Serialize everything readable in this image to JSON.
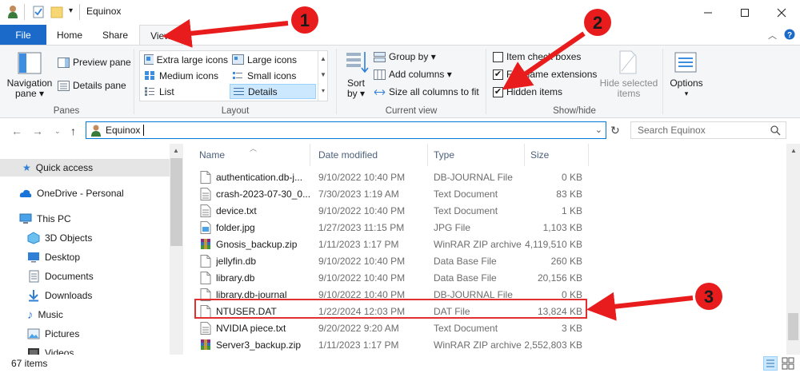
{
  "window": {
    "title": "Equinox",
    "minimize": "—",
    "maximize": "☐",
    "close": "✕"
  },
  "tabs": {
    "file": "File",
    "home": "Home",
    "share": "Share",
    "view": "View"
  },
  "ribbon": {
    "panes": {
      "label": "Panes",
      "navigation_pane": [
        "Navigation",
        "pane ▾"
      ],
      "preview_pane": "Preview pane",
      "details_pane": "Details pane"
    },
    "layout": {
      "label": "Layout",
      "items": [
        "Extra large icons",
        "Large icons",
        "Medium icons",
        "Small icons",
        "List",
        "Details"
      ],
      "selected": "Details"
    },
    "current_view": {
      "label": "Current view",
      "sort_by": [
        "Sort",
        "by ▾"
      ],
      "group_by": "Group by ▾",
      "add_columns": "Add columns ▾",
      "size_all_columns": "Size all columns to fit"
    },
    "show_hide": {
      "label": "Show/hide",
      "item_check_boxes": {
        "label": "Item check boxes",
        "checked": false
      },
      "file_name_extensions": {
        "label": "File name extensions",
        "checked": true
      },
      "hidden_items": {
        "label": "Hidden items",
        "checked": true
      },
      "hide_selected": [
        "Hide selected",
        "items"
      ]
    },
    "options": "Options"
  },
  "address": {
    "path": "Equinox",
    "search_placeholder": "Search Equinox"
  },
  "nav_pane": {
    "items": [
      {
        "label": "Quick access",
        "icon": "star-icon",
        "selected": true
      },
      {
        "label": "OneDrive - Personal",
        "icon": "cloud-icon"
      },
      {
        "label": "This PC",
        "icon": "computer-icon"
      },
      {
        "label": "3D Objects",
        "icon": "cube-icon"
      },
      {
        "label": "Desktop",
        "icon": "desktop-icon"
      },
      {
        "label": "Documents",
        "icon": "documents-icon"
      },
      {
        "label": "Downloads",
        "icon": "download-icon"
      },
      {
        "label": "Music",
        "icon": "music-icon"
      },
      {
        "label": "Pictures",
        "icon": "pictures-icon"
      },
      {
        "label": "Videos",
        "icon": "videos-icon"
      }
    ]
  },
  "columns": {
    "name": "Name",
    "date": "Date modified",
    "type": "Type",
    "size": "Size"
  },
  "files": [
    {
      "name": "authentication.db-j...",
      "date": "9/10/2022 10:40 PM",
      "type": "DB-JOURNAL File",
      "size": "0 KB",
      "icon": "file-icon"
    },
    {
      "name": "crash-2023-07-30_0...",
      "date": "7/30/2023 1:19 AM",
      "type": "Text Document",
      "size": "83 KB",
      "icon": "text-file-icon"
    },
    {
      "name": "device.txt",
      "date": "9/10/2022 10:40 PM",
      "type": "Text Document",
      "size": "1 KB",
      "icon": "text-file-icon"
    },
    {
      "name": "folder.jpg",
      "date": "1/27/2023 11:15 PM",
      "type": "JPG File",
      "size": "1,103 KB",
      "icon": "image-file-icon"
    },
    {
      "name": "Gnosis_backup.zip",
      "date": "1/11/2023 1:17 PM",
      "type": "WinRAR ZIP archive",
      "size": "4,119,510 KB",
      "icon": "winrar-icon"
    },
    {
      "name": "jellyfin.db",
      "date": "9/10/2022 10:40 PM",
      "type": "Data Base File",
      "size": "260 KB",
      "icon": "file-icon"
    },
    {
      "name": "library.db",
      "date": "9/10/2022 10:40 PM",
      "type": "Data Base File",
      "size": "20,156 KB",
      "icon": "file-icon"
    },
    {
      "name": "library.db-journal",
      "date": "9/10/2022 10:40 PM",
      "type": "DB-JOURNAL File",
      "size": "0 KB",
      "icon": "file-icon"
    },
    {
      "name": "NTUSER.DAT",
      "date": "1/22/2024 12:03 PM",
      "type": "DAT File",
      "size": "13,824 KB",
      "icon": "file-icon"
    },
    {
      "name": "NVIDIA piece.txt",
      "date": "9/20/2022 9:20 AM",
      "type": "Text Document",
      "size": "3 KB",
      "icon": "text-file-icon"
    },
    {
      "name": "Server3_backup.zip",
      "date": "1/11/2023 1:17 PM",
      "type": "WinRAR ZIP archive",
      "size": "2,552,803 KB",
      "icon": "winrar-icon"
    }
  ],
  "status": {
    "count": "67 items"
  },
  "annotations": [
    "1",
    "2",
    "3"
  ],
  "colors": {
    "accent": "#1b6ac9",
    "arrow": "#e81c1c",
    "highlight": "#e03030"
  }
}
